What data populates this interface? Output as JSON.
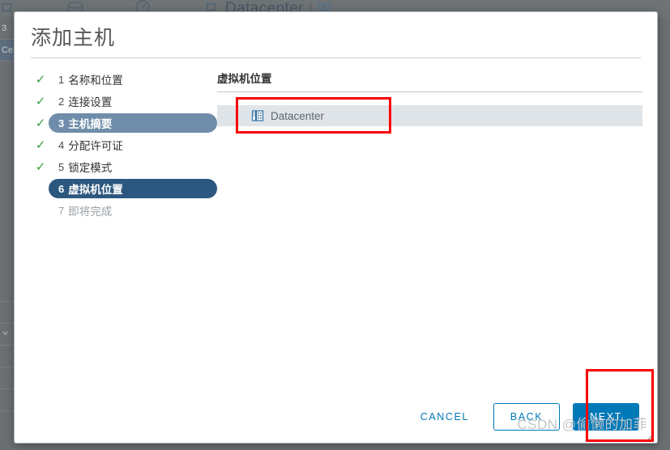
{
  "backdrop": {
    "title": "Datacenter",
    "icons": [
      "database-icon",
      "gauge-icon",
      "monitor-icon",
      "chart-icon"
    ],
    "left_rows": [
      {
        "text": "3",
        "selected": false
      },
      {
        "text": "Ce",
        "selected": true
      }
    ]
  },
  "modal": {
    "title": "添加主机",
    "steps": [
      {
        "num": "1",
        "label": "名称和位置",
        "state": "done"
      },
      {
        "num": "2",
        "label": "连接设置",
        "state": "done"
      },
      {
        "num": "3",
        "label": "主机摘要",
        "state": "done-hovered"
      },
      {
        "num": "4",
        "label": "分配许可证",
        "state": "done"
      },
      {
        "num": "5",
        "label": "锁定模式",
        "state": "done"
      },
      {
        "num": "6",
        "label": "虚拟机位置",
        "state": "active"
      },
      {
        "num": "7",
        "label": "即将完成",
        "state": "upcoming"
      }
    ],
    "content": {
      "heading": "虚拟机位置",
      "tree": [
        {
          "icon": "datacenter-icon",
          "label": "Datacenter",
          "selected": true
        }
      ]
    },
    "footer": {
      "cancel_label": "CANCEL",
      "back_label": "BACK",
      "next_label": "NEXT"
    }
  },
  "watermark": {
    "text": "CSDN @偷懒的加菲"
  },
  "colors": {
    "primary_blue": "#0079b8",
    "active_step": "#2c587f",
    "hovered_step": "#6f8daa",
    "check_green": "#3a9e3a",
    "row_selected": "#dfe4e8",
    "annotation_red": "#fb0000",
    "backdrop": "#6b6f72"
  }
}
